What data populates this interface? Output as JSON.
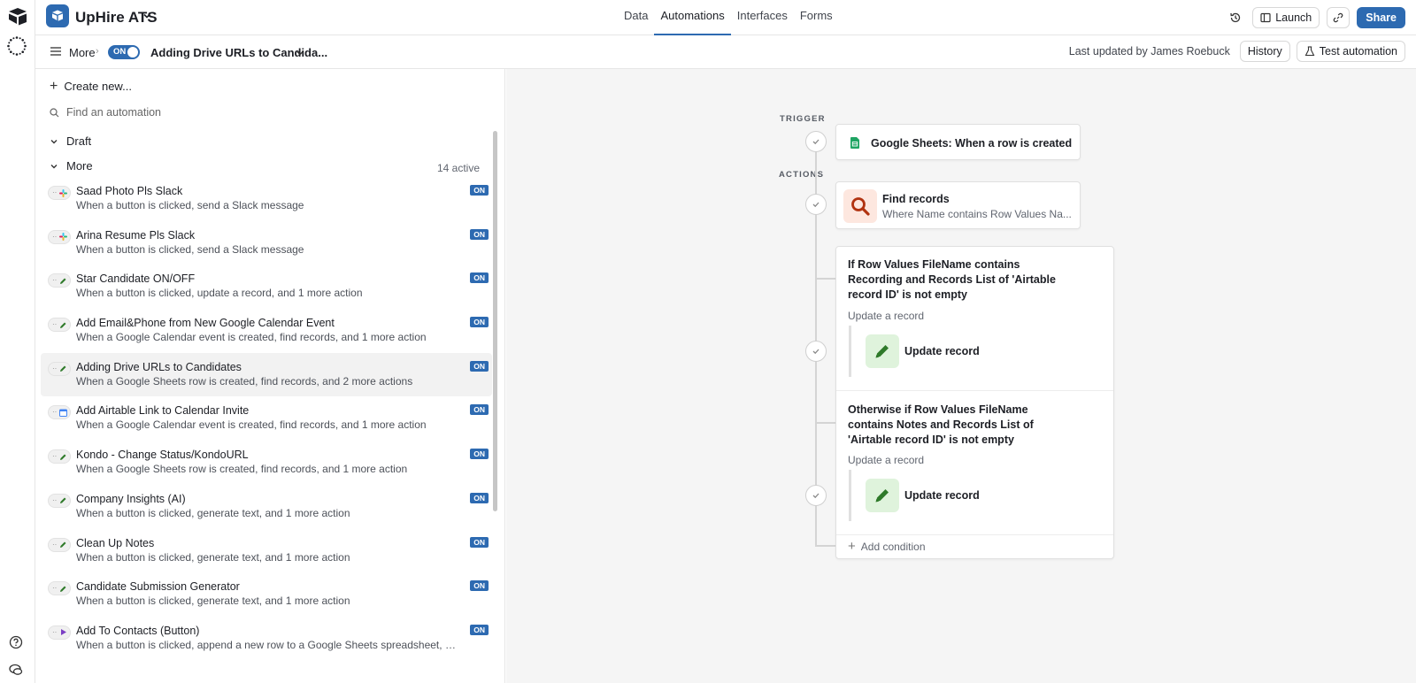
{
  "topbar": {
    "base_name": "UpHire ATS",
    "tabs": [
      {
        "label": "Data",
        "active": false
      },
      {
        "label": "Automations",
        "active": true
      },
      {
        "label": "Interfaces",
        "active": false
      },
      {
        "label": "Forms",
        "active": false
      }
    ],
    "launch_label": "Launch",
    "share_label": "Share",
    "accent_color": "#2d6ab1"
  },
  "subbar": {
    "crumb": "More",
    "toggle_label": "ON",
    "automation_title": "Adding Drive URLs to Candida...",
    "last_updated": "Last updated by James Roebuck",
    "history_label": "History",
    "test_label": "Test automation"
  },
  "panel": {
    "create_label": "Create new...",
    "search_placeholder": "Find an automation",
    "group_draft": "Draft",
    "group_more": "More",
    "active_count": "14 active",
    "badge_label": "ON",
    "items": [
      {
        "name": "Saad Photo Pls Slack",
        "desc": "When a button is clicked, send a Slack message",
        "icon": "slack-icon"
      },
      {
        "name": "Arina Resume Pls Slack",
        "desc": "When a button is clicked, send a Slack message",
        "icon": "slack-icon"
      },
      {
        "name": "Star Candidate ON/OFF",
        "desc": "When a button is clicked, update a record, and 1 more action",
        "icon": "pencil-icon"
      },
      {
        "name": "Add Email&Phone from New Google Calendar Event",
        "desc": "When a Google Calendar event is created, find records, and 1 more action",
        "icon": "pencil-icon"
      },
      {
        "name": "Adding Drive URLs to Candidates",
        "desc": "When a Google Sheets row is created, find records, and 2 more actions",
        "icon": "pencil-icon",
        "selected": true
      },
      {
        "name": "Add Airtable Link to Calendar Invite",
        "desc": "When a Google Calendar event is created, find records, and 1 more action",
        "icon": "calendar-icon"
      },
      {
        "name": "Kondo - Change Status/KondoURL",
        "desc": "When a Google Sheets row is created, find records, and 1 more action",
        "icon": "pencil-icon"
      },
      {
        "name": "Company Insights (AI)",
        "desc": "When a button is clicked, generate text, and 1 more action",
        "icon": "pencil-icon"
      },
      {
        "name": "Clean Up Notes",
        "desc": "When a button is clicked, generate text, and 1 more action",
        "icon": "pencil-icon"
      },
      {
        "name": "Candidate Submission Generator",
        "desc": "When a button is clicked, generate text, and 1 more action",
        "icon": "pencil-icon"
      },
      {
        "name": "Add To Contacts (Button)",
        "desc": "When a button is clicked, append a new row to a Google Sheets spreadsheet, and 1 mor...",
        "icon": "play-icon"
      }
    ]
  },
  "canvas": {
    "trigger_label": "TRIGGER",
    "actions_label": "ACTIONS",
    "trigger_card": "Google Sheets: When a row is created",
    "find_title": "Find records",
    "find_sub": "Where Name contains Row Values Na...",
    "cond1": "If Row Values FileName contains Recording and Records List of 'Airtable record ID' is not empty",
    "cond1_sub": "Update a record",
    "cond1_action": "Update record",
    "cond2": "Otherwise if Row Values FileName contains Notes and Records List of 'Airtable record ID' is not empty",
    "cond2_sub": "Update a record",
    "cond2_action": "Update record",
    "add_condition": "Add condition"
  }
}
